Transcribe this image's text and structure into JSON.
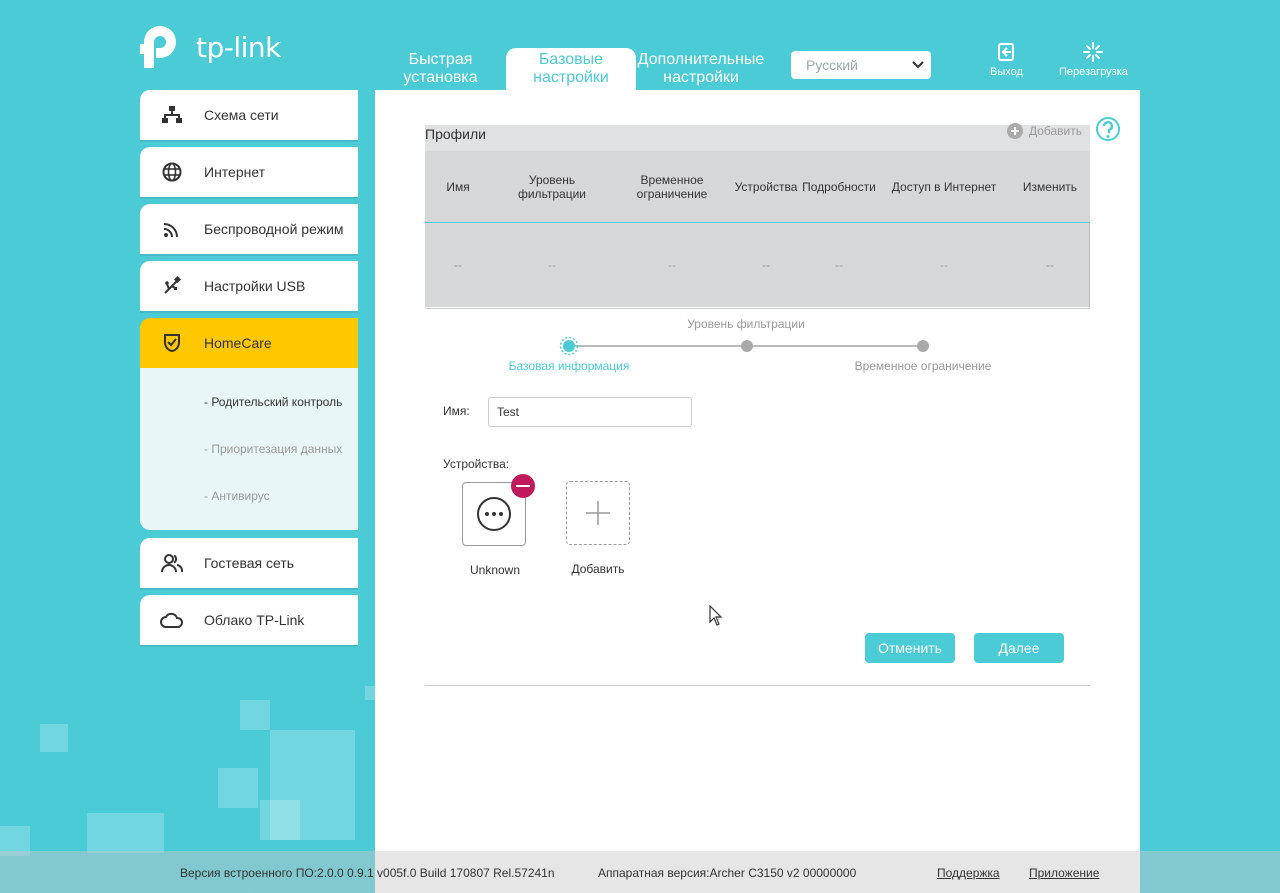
{
  "brand": {
    "logo_text": "tp-link"
  },
  "tabs": [
    {
      "label": "Быстрая установка"
    },
    {
      "label": "Базовые настройки"
    },
    {
      "label": "Дополнительные настройки"
    }
  ],
  "language": {
    "selected": "Русский"
  },
  "header_buttons": {
    "logout": "Выход",
    "reboot": "Перезагрузка"
  },
  "sidebar": {
    "items": [
      {
        "label": "Схема сети",
        "icon": "network-map-icon"
      },
      {
        "label": "Интернет",
        "icon": "globe-icon"
      },
      {
        "label": "Беспроводной режим",
        "icon": "wireless-icon"
      },
      {
        "label": "Настройки USB",
        "icon": "usb-icon"
      },
      {
        "label": "HomeCare",
        "icon": "shield-icon"
      },
      {
        "label": "Гостевая сеть",
        "icon": "guest-users-icon"
      },
      {
        "label": "Облако TP-Link",
        "icon": "cloud-icon"
      }
    ],
    "homecare_sub": [
      {
        "label": "- Родительский контроль"
      },
      {
        "label": "- Приоритезация данных"
      },
      {
        "label": "- Антивирус"
      }
    ]
  },
  "profiles": {
    "title": "Профили",
    "add_label": "Добавить",
    "columns": [
      "Имя",
      "Уровень фильтрации",
      "Временное ограничение",
      "Устройства",
      "Подробности",
      "Доступ в Интернет",
      "Изменить"
    ],
    "row": [
      "--",
      "--",
      "--",
      "--",
      "--",
      "--",
      "--"
    ]
  },
  "stepper": {
    "steps": [
      "Базовая информация",
      "Уровень фильтрации",
      "Временное ограничение"
    ],
    "current": 0
  },
  "form": {
    "name_label": "Имя:",
    "name_value": "Test",
    "devices_label": "Устройства:",
    "devices": [
      {
        "label": "Unknown"
      }
    ],
    "add_device_label": "Добавить"
  },
  "buttons": {
    "cancel": "Отменить",
    "next": "Далее"
  },
  "footer": {
    "firmware": "Версия встроенного ПО:2.0.0 0.9.1 v005f.0 Build 170807 Rel.57241n",
    "hardware": "Аппаратная версия:Archer C3150 v2 00000000",
    "support": "Поддержка",
    "app": "Приложение"
  },
  "colors": {
    "accent": "#4acbd6",
    "active_nav": "#ffc700",
    "remove": "#c0195c"
  }
}
